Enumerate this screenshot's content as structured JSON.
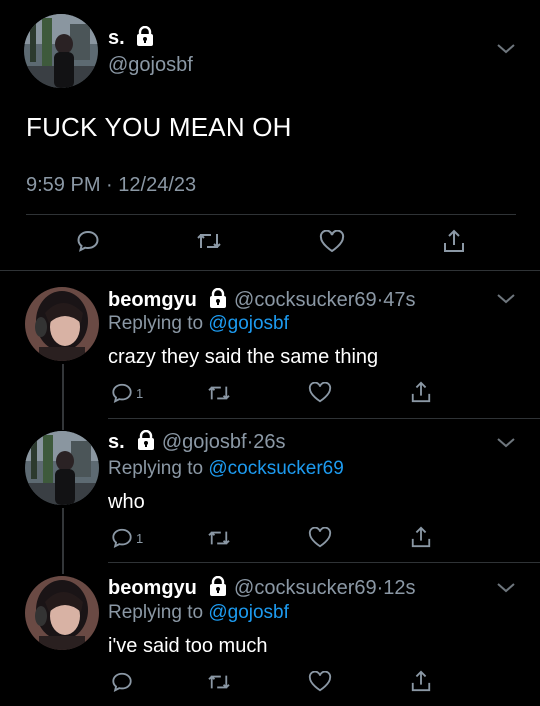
{
  "main_tweet": {
    "display_name": "s.",
    "handle": "@gojosbf",
    "text": "FUCK YOU MEAN OH",
    "time": "9:59 PM",
    "date": "12/24/23",
    "separator": "·"
  },
  "replies": [
    {
      "display_name": "beomgyu",
      "handle": "@cocksucker69",
      "age": "47s",
      "replying_prefix": "Replying to",
      "replying_to": "@gojosbf",
      "text": "crazy they said the same thing",
      "reply_count": "1"
    },
    {
      "display_name": "s.",
      "handle": "@gojosbf",
      "age": "26s",
      "replying_prefix": "Replying to",
      "replying_to": "@cocksucker69",
      "text": "who",
      "reply_count": "1"
    },
    {
      "display_name": "beomgyu",
      "handle": "@cocksucker69",
      "age": "12s",
      "replying_prefix": "Replying to",
      "replying_to": "@gojosbf",
      "text": "i've said too much",
      "reply_count": ""
    }
  ],
  "separator": "·",
  "colors": {
    "background": "#000000",
    "muted": "#8b98a5",
    "link": "#1d9bf0"
  },
  "icons": [
    "reply-icon",
    "retweet-icon",
    "like-icon",
    "share-icon",
    "lock-icon",
    "chevron-down-icon"
  ]
}
